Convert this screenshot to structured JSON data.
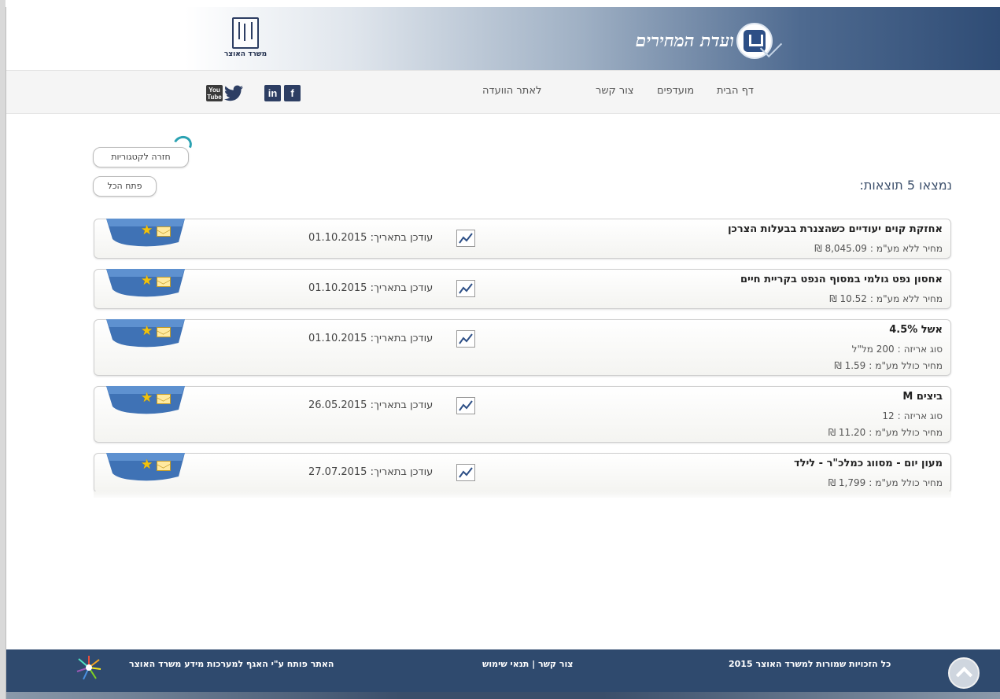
{
  "header": {
    "site_title": "ועדת המחירים",
    "ministry_name": "משרד האוצר"
  },
  "nav": {
    "items": [
      "דף הבית",
      "מועדפים",
      "צור קשר",
      "לאתר הוועדה"
    ],
    "social": {
      "facebook": "f",
      "linkedin": "in",
      "twitter": "🐦",
      "youtube": "You Tube"
    }
  },
  "actions": {
    "back_label": "חזרה לקטגוריות",
    "open_all_label": "פתח הכל"
  },
  "results_text": "נמצאו 5 תוצאות:",
  "updated_label": "עודכן בתאריך:",
  "items": [
    {
      "title": "אחזקת קוים יעודיים כשהצנרת בבעלות הצרכן",
      "lines": [
        {
          "label": "מחיר ללא מע\"מ",
          "value": "8,045.09 ₪"
        }
      ],
      "date": "01.10.2015"
    },
    {
      "title": "אחסון נפט גולמי במסוף הנפט בקריית חיים",
      "lines": [
        {
          "label": "מחיר ללא מע\"מ",
          "value": "10.52 ₪"
        }
      ],
      "date": "01.10.2015"
    },
    {
      "title": "אשל 4.5%",
      "lines": [
        {
          "label": "סוג אריזה",
          "value": "200 מל\"ל"
        },
        {
          "label": "מחיר כולל מע\"מ",
          "value": "1.59 ₪"
        }
      ],
      "date": "01.10.2015"
    },
    {
      "title": "ביצים M",
      "lines": [
        {
          "label": "סוג אריזה",
          "value": "12"
        },
        {
          "label": "מחיר כולל מע\"מ",
          "value": "11.20 ₪"
        }
      ],
      "date": "26.05.2015"
    },
    {
      "title": "מעון יום - מסווג כמלכ\"ר - לילד",
      "lines": [
        {
          "label": "מחיר כולל מע\"מ",
          "value": "1,799 ₪"
        }
      ],
      "date": "27.07.2015"
    }
  ],
  "footer": {
    "copyright": "כל הזכויות שמורות למשרד האוצר 2015",
    "contact": "צור קשר",
    "separator": "|",
    "terms": "תנאי שימוש",
    "developed_by": "האתר פותח ע\"י האגף למערכות מידע משרד האוצר"
  },
  "colors": {
    "header_dark": "#2f4c75",
    "footer": "#2f4a6e",
    "ribbon": "#3f72b5",
    "star": "#f2c20a"
  }
}
